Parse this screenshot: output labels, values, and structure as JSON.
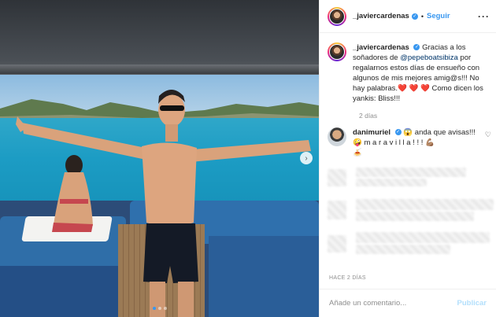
{
  "post": {
    "author": "_javiercardenas",
    "follow_label": "Seguir",
    "separator": "•",
    "more_label": "···",
    "caption": {
      "author": "_javiercardenas",
      "text_before": "Gracias a los soñadores de ",
      "mention": "@pepeboatsibiza",
      "text_after": " por regalarnos estos días de ensueño con algunos de mis mejores amig@s!!! No hay palabras.",
      "hearts": "❤️ ❤️ ❤️",
      "text_end": "  Como dicen los yankis: Bliss!!!"
    },
    "caption_time": "2 días",
    "top_comment": {
      "author": "danimuriel",
      "text": " 😱  anda que avisas!!! 🤪  m a r a v i l l a ! ! ! 💪🏽",
      "extra": "🍝"
    },
    "posted_label": "HACE 2 DÍAS",
    "comment_placeholder": "Añade un comentario...",
    "publish_label": "Publicar"
  },
  "icons": {
    "verified": "verified-badge-icon",
    "next": "chevron-right-icon",
    "like_comment": "heart-outline-icon"
  },
  "colors": {
    "link": "#3897f0",
    "mention": "#003569",
    "heart": "#ed4956",
    "muted": "#8e8e8e"
  },
  "carousel": {
    "slides": 3,
    "active": 1
  }
}
